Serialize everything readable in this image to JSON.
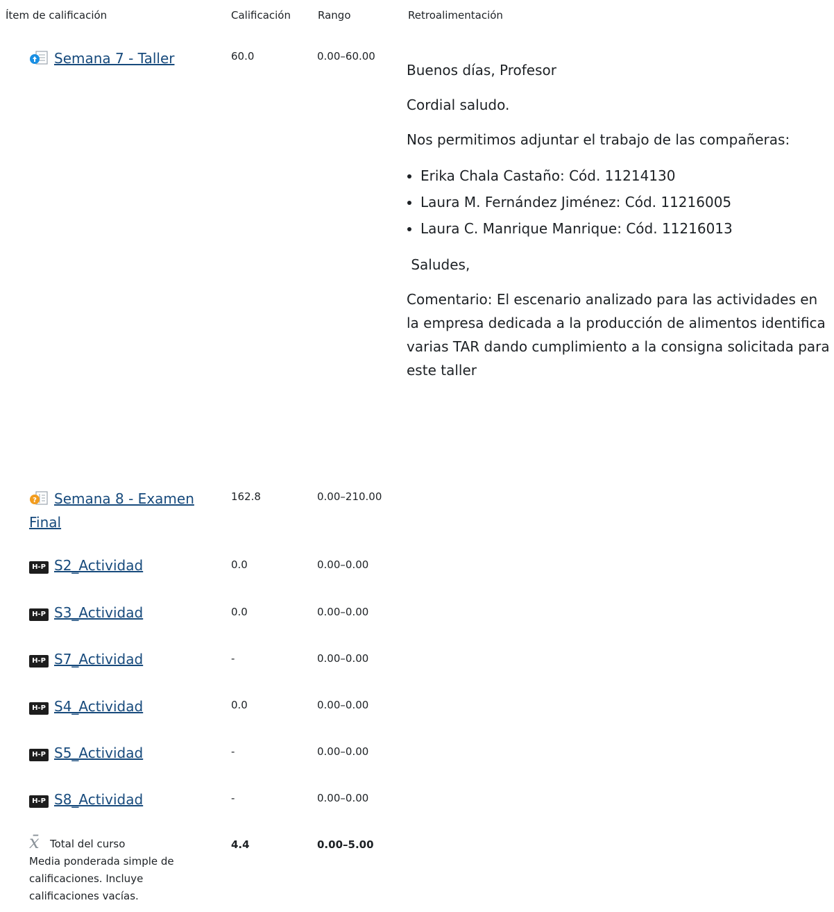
{
  "header": {
    "item": "Ítem de calificación",
    "grade": "Calificación",
    "range": "Rango",
    "feedback": "Retroalimentación"
  },
  "items": [
    {
      "name_line1": "Semana 7 - Taller",
      "grade": "60.0",
      "range": "0.00–60.00",
      "icon": "assignment-icon",
      "feedback": {
        "greeting": "Buenos días, Profesor",
        "salute": "Cordial saludo.",
        "intro": "Nos permitimos adjuntar el trabajo de las compañeras:",
        "students": [
          "Erika Chala Castaño: Cód. 11214130",
          "Laura M. Fernández Jiménez: Cód. 11216005",
          " Laura C. Manrique Manrique: Cód. 11216013"
        ],
        "closing": " Saludes,",
        "comment": " Comentario: El escenario analizado para las actividades en la empresa dedicada a la producción de alimentos identifica varias TAR dando cumplimiento a la consigna solicitada para este taller"
      }
    },
    {
      "name_line1": "Semana 8 - Examen",
      "name_line2": "Final",
      "grade": "162.8",
      "range": "0.00–210.00",
      "icon": "quiz-icon"
    },
    {
      "name_line1": "S2_Actividad",
      "grade": "0.0",
      "range": "0.00–0.00",
      "icon": "h5p-icon"
    },
    {
      "name_line1": "S3_Actividad",
      "grade": "0.0",
      "range": "0.00–0.00",
      "icon": "h5p-icon"
    },
    {
      "name_line1": "S7_Actividad",
      "grade": "-",
      "range": "0.00–0.00",
      "icon": "h5p-icon"
    },
    {
      "name_line1": "S4_Actividad",
      "grade": "0.0",
      "range": "0.00–0.00",
      "icon": "h5p-icon"
    },
    {
      "name_line1": "S5_Actividad",
      "grade": "-",
      "range": "0.00–0.00",
      "icon": "h5p-icon"
    },
    {
      "name_line1": "S8_Actividad",
      "grade": "-",
      "range": "0.00–0.00",
      "icon": "h5p-icon"
    }
  ],
  "h5p_badge_text": "H-P",
  "total": {
    "label": "Total del curso",
    "description": "Media ponderada simple de calificaciones. Incluye calificaciones vacías.",
    "grade": "4.4",
    "range": "0.00–5.00",
    "icon": "mean-icon"
  },
  "colors": {
    "link": "#174a7c",
    "text": "#1d2125",
    "assign_blue": "#1a8fe3",
    "quiz_orange": "#f29c1e"
  }
}
